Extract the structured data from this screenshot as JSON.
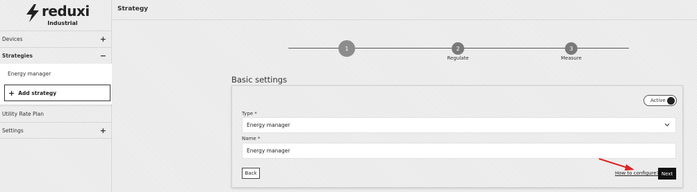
{
  "brand": {
    "name": "reduxi",
    "tagline": "Industrial",
    "icon": "bolt-icon"
  },
  "sidebar": {
    "items": [
      {
        "label": "Devices",
        "symbol": "+"
      },
      {
        "label": "Strategies",
        "symbol": "−"
      },
      {
        "label": "Utility Rate Plan",
        "symbol": ""
      },
      {
        "label": "Settings",
        "symbol": "+"
      }
    ],
    "sub_item": "Energy manager",
    "add_strategy_label": "Add strategy",
    "add_strategy_symbol": "+"
  },
  "header": {
    "title": "Strategy"
  },
  "stepper": {
    "steps": [
      {
        "number": "1",
        "label": ""
      },
      {
        "number": "2",
        "label": "Regulate"
      },
      {
        "number": "3",
        "label": "Measure"
      }
    ]
  },
  "form": {
    "section_title": "Basic settings",
    "toggle_label": "Active",
    "type_label": "Type *",
    "type_value": "Energy manager",
    "name_label": "Name *",
    "name_value": "Energy manager",
    "back_label": "Back",
    "help_link": "How to configure?",
    "next_label": "Next"
  },
  "colors": {
    "annotation_arrow": "#e02020",
    "primary_button": "#111111"
  }
}
